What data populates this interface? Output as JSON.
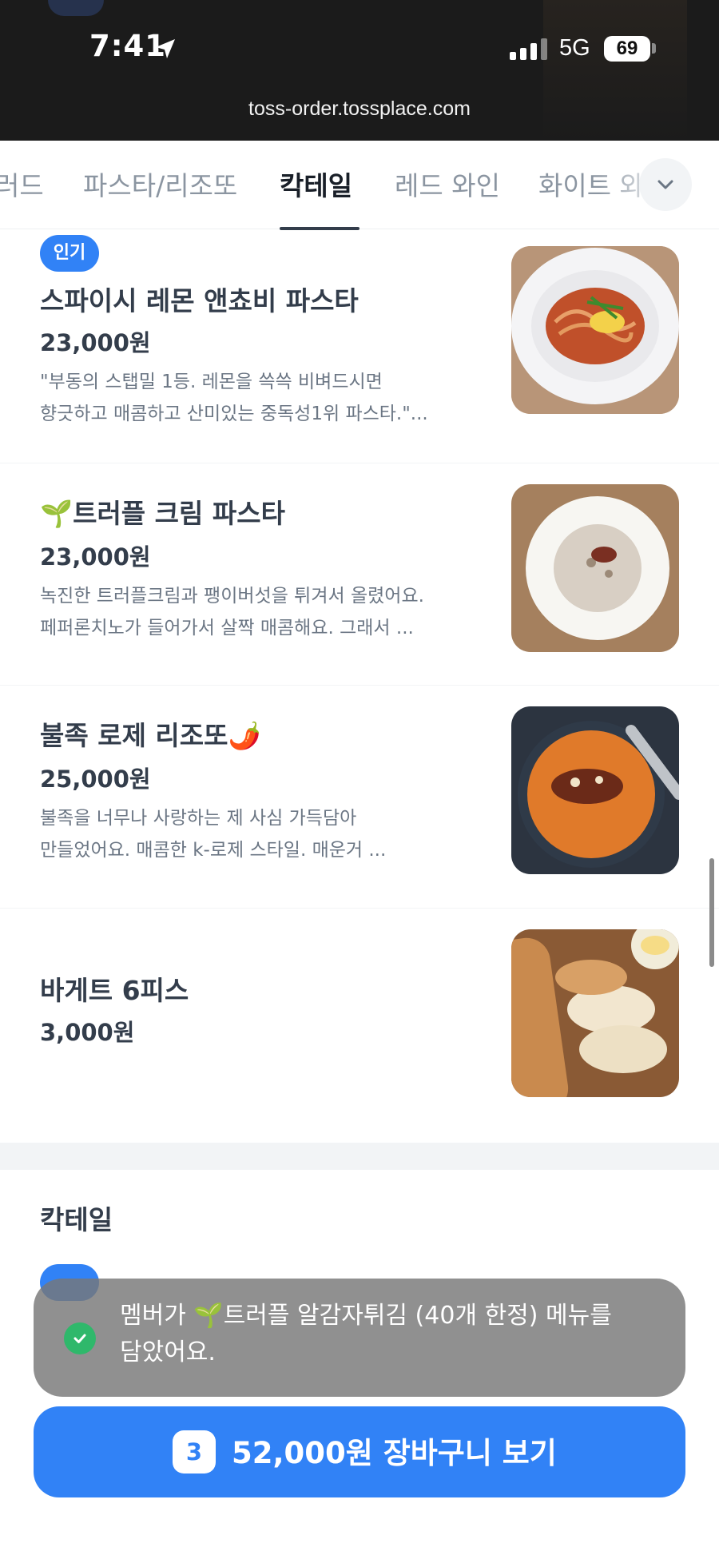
{
  "status_bar": {
    "time": "7:41",
    "network": "5G",
    "battery": "69"
  },
  "browser": {
    "url": "toss-order.tossplace.com"
  },
  "tabs": [
    {
      "label": "러드"
    },
    {
      "label": "파스타/리조또"
    },
    {
      "label": "칵테일"
    },
    {
      "label": "레드 와인"
    },
    {
      "label": "화이트 와"
    }
  ],
  "active_tab": "칵테일",
  "menu": [
    {
      "badge": "인기",
      "name": "스파이시 레몬 앤쵸비 파스타",
      "price": "23,000원",
      "desc_line1": "\"부동의 스탭밀 1등. 레몬을 쓱쓱 비벼드시면",
      "desc_line2": "향긋하고 매콤하고 산미있는 중독성1위 파스타.\"...",
      "image": "spicy-lemon-anchovy-pasta-photo"
    },
    {
      "name": "🌱트러플 크림 파스타",
      "price": "23,000원",
      "desc_line1": "녹진한 트러플크림과 팽이버섯을 튀겨서 올렸어요.",
      "desc_line2": "페퍼론치노가 들어가서 살짝 매콤해요. 그래서 ...",
      "image": "truffle-cream-pasta-photo"
    },
    {
      "name": "불족 로제 리조또🌶️",
      "price": "25,000원",
      "desc_line1": "불족을 너무나 사랑하는 제 사심 가득담아",
      "desc_line2": "만들었어요. 매콤한 k-로제 스타일. 매운거 ...",
      "image": "rose-risotto-photo"
    },
    {
      "name": "바게트 6피스",
      "price": "3,000원",
      "image": "baguette-photo"
    }
  ],
  "next_section": {
    "title": "칵테일"
  },
  "toast": {
    "message": "멤버가 🌱트러플 알감자튀김 (40개 한정) 메뉴를 담았어요."
  },
  "cart": {
    "count": "3",
    "label": "52,000원 장바구니 보기"
  },
  "colors": {
    "accent": "#3182f6",
    "toast": "#787878",
    "check": "#2fb86b"
  }
}
